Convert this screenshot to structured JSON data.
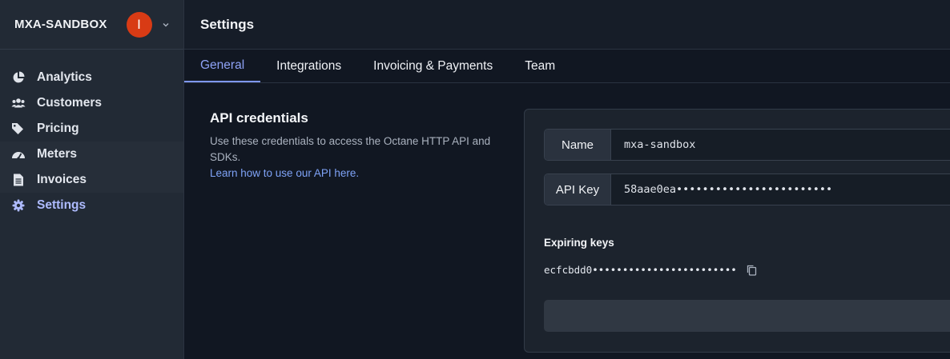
{
  "sidebar": {
    "org_name": "MXA-SANDBOX",
    "avatar_initial": "I",
    "avatar_color": "#d83b15",
    "items": [
      {
        "label": "Analytics",
        "icon": "pie-chart-icon"
      },
      {
        "label": "Customers",
        "icon": "users-icon"
      },
      {
        "label": "Pricing",
        "icon": "tag-icon"
      },
      {
        "label": "Meters",
        "icon": "gauge-icon"
      },
      {
        "label": "Invoices",
        "icon": "document-icon"
      },
      {
        "label": "Settings",
        "icon": "gear-icon",
        "active": true
      }
    ]
  },
  "header": {
    "title": "Settings"
  },
  "tabs": [
    {
      "label": "General",
      "active": true
    },
    {
      "label": "Integrations"
    },
    {
      "label": "Invoicing & Payments"
    },
    {
      "label": "Team"
    }
  ],
  "api": {
    "title": "API credentials",
    "description": "Use these credentials to access the Octane HTTP API and SDKs.",
    "link": "Learn how to use our API here."
  },
  "credentials": {
    "name_label": "Name",
    "name_value": "mxa-sandbox",
    "key_label": "API Key",
    "key_value": "58aae0ea••••••••••••••••••••••••"
  },
  "expiring": {
    "title": "Expiring keys",
    "key": "ecfcbdd0••••••••••••••••••••••••"
  },
  "colors": {
    "accent": "#8ea2f5",
    "link": "#7fa3f7",
    "background": "#111722"
  }
}
